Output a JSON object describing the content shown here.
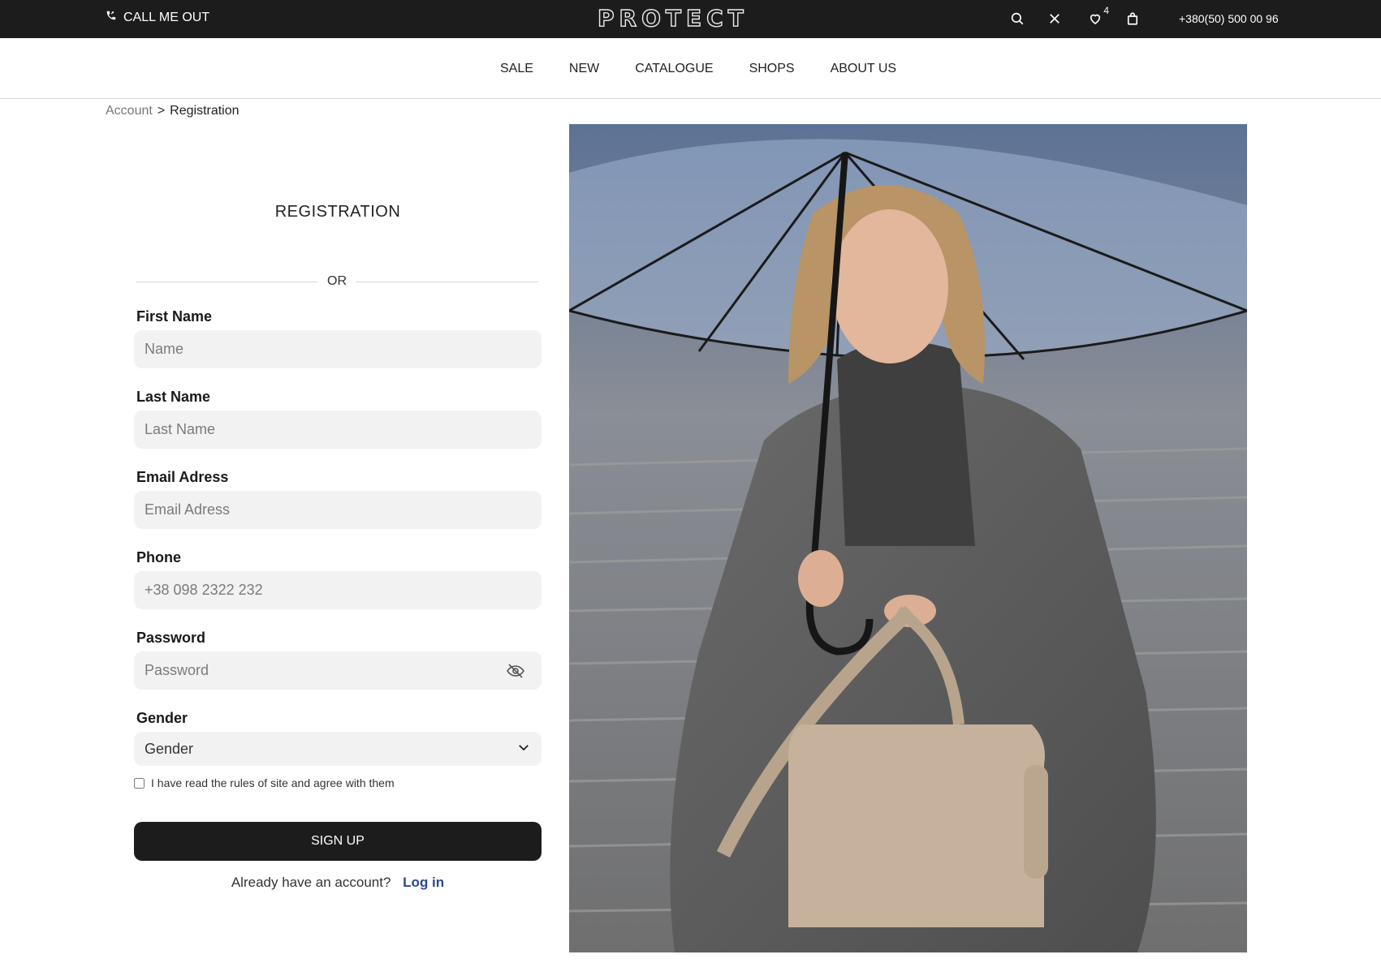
{
  "topbar": {
    "call_label": "CALL ME OUT",
    "logo": "PROTECT",
    "wishlist_count": "4",
    "phone": "+380(50) 500 00 96"
  },
  "nav": {
    "items": [
      {
        "label": "SALE"
      },
      {
        "label": "NEW"
      },
      {
        "label": "CATALOGUE"
      },
      {
        "label": "SHOPS"
      },
      {
        "label": "ABOUT US"
      }
    ]
  },
  "breadcrumb": {
    "parent": "Account",
    "separator": ">",
    "current": "Registration"
  },
  "form": {
    "title": "REGISTRATION",
    "divider_text": "OR",
    "first_name": {
      "label": "First Name",
      "placeholder": "Name"
    },
    "last_name": {
      "label": "Last Name",
      "placeholder": "Last Name"
    },
    "email": {
      "label": "Email Adress",
      "placeholder": "Email Adress"
    },
    "phone": {
      "label": "Phone",
      "placeholder": "+38 098 2322 232"
    },
    "password": {
      "label": "Password",
      "placeholder": "Password"
    },
    "gender": {
      "label": "Gender",
      "value": "Gender"
    },
    "agree_text": "I have read the rules of site and agree with them",
    "signup_label": "SIGN UP",
    "have_account_text": "Already have an account?",
    "login_label": "Log in"
  },
  "colors": {
    "topbar_bg": "#1c1c1c",
    "input_bg": "#f2f2f2",
    "link": "#2c4a8a"
  }
}
